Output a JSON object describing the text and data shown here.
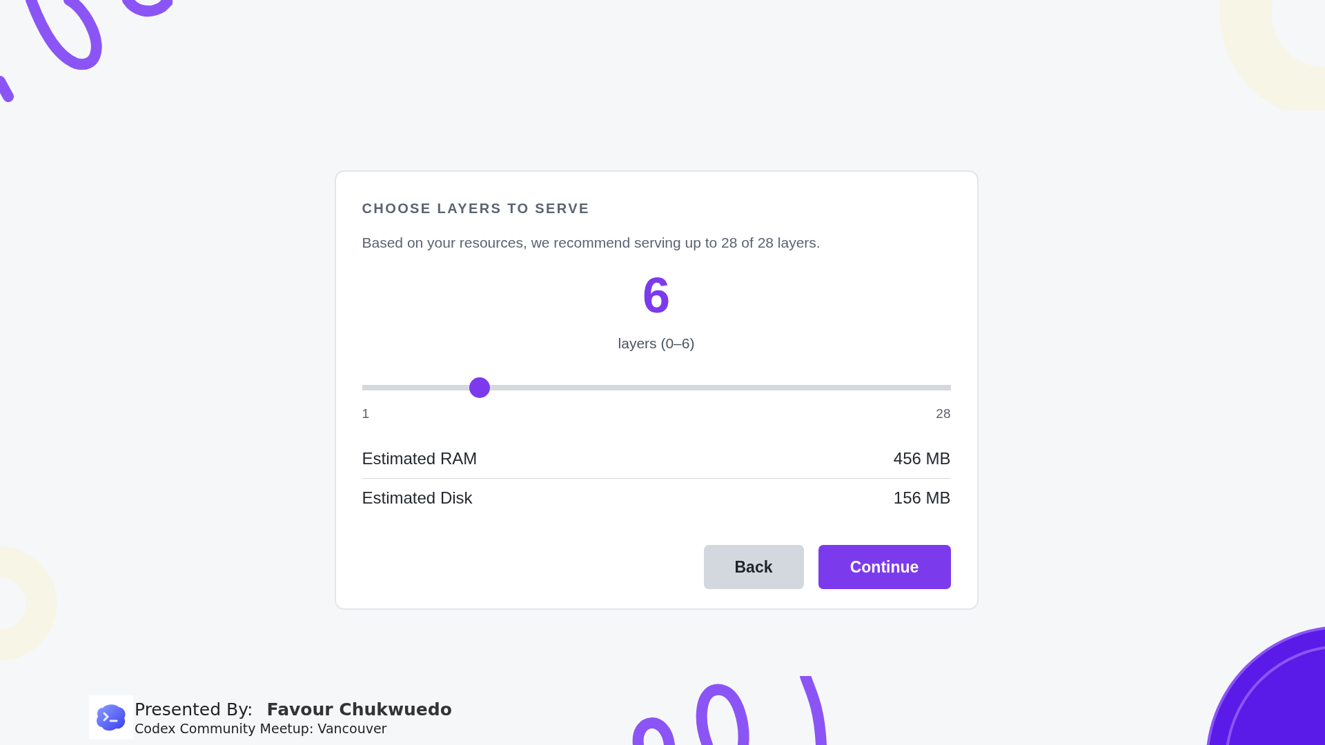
{
  "card": {
    "title": "CHOOSE LAYERS TO SERVE",
    "description": "Based on your resources, we recommend serving up to 28 of 28 layers.",
    "value": "6",
    "value_caption": "layers (0–6)",
    "slider": {
      "level": 0.2,
      "min_label": "1",
      "max_label": "28"
    },
    "estimates": [
      {
        "label": "Estimated RAM",
        "value": "456 MB"
      },
      {
        "label": "Estimated Disk",
        "value": "156 MB"
      }
    ],
    "buttons": [
      {
        "label": "Back",
        "kind": "secondary"
      },
      {
        "label": "Continue",
        "kind": "primary"
      }
    ]
  },
  "footer": {
    "presented_by_label": "Presented By:",
    "presenter": "Favour Chukwuedo",
    "event": "Codex Community Meetup: Vancouver"
  }
}
